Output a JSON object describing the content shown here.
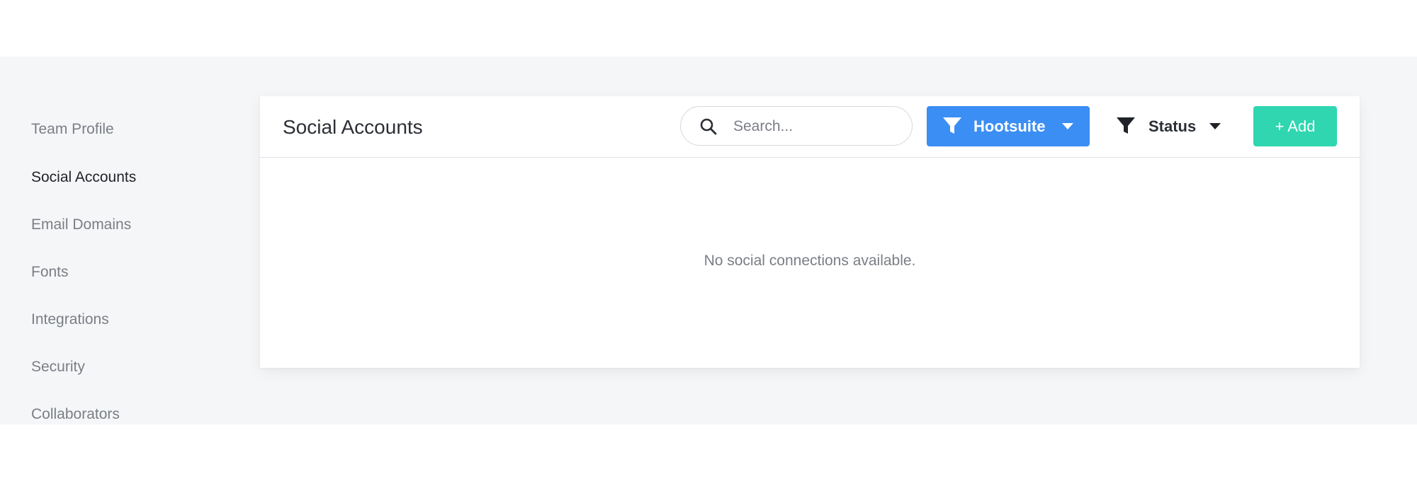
{
  "sidebar": {
    "items": [
      {
        "label": "Team Profile",
        "active": false
      },
      {
        "label": "Social Accounts",
        "active": true
      },
      {
        "label": "Email Domains",
        "active": false
      },
      {
        "label": "Fonts",
        "active": false
      },
      {
        "label": "Integrations",
        "active": false
      },
      {
        "label": "Security",
        "active": false
      },
      {
        "label": "Collaborators",
        "active": false
      }
    ]
  },
  "main": {
    "title": "Social Accounts",
    "search": {
      "placeholder": "Search...",
      "value": ""
    },
    "filter": {
      "label": "Hootsuite",
      "icon": "funnel-icon",
      "color": "#3b8ef3"
    },
    "status": {
      "label": "Status",
      "icon": "funnel-icon"
    },
    "add": {
      "label": "+ Add",
      "color": "#2fd6b0"
    },
    "empty_message": "No social connections available."
  }
}
